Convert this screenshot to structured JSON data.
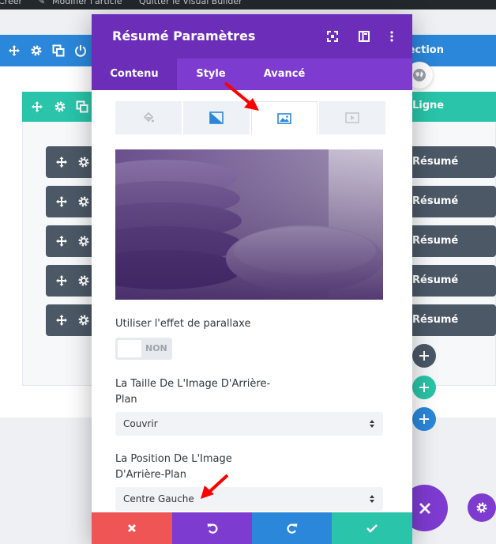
{
  "top_bar": {
    "items": [
      "Créer",
      "Modifier l'article",
      "Quitter le Visual Builder"
    ]
  },
  "section": {
    "label": "Section"
  },
  "row": {
    "label": "Ligne"
  },
  "modules": [
    {
      "label": "Résumé"
    },
    {
      "label": "Résumé"
    },
    {
      "label": "Résumé"
    },
    {
      "label": "Résumé"
    },
    {
      "label": "Résumé"
    }
  ],
  "modal": {
    "title": "Résumé Paramètres",
    "tabs": [
      "Contenu",
      "Style",
      "Avancé"
    ],
    "active_tab": "Contenu",
    "background_tabs": [
      "color-icon",
      "gradient-icon",
      "image-icon",
      "video-icon"
    ],
    "active_background_tab": "image-icon",
    "parallax": {
      "label": "Utiliser l'effet de parallaxe",
      "value": "NON"
    },
    "image_size": {
      "label_line1": "La Taille De L'Image D'Arrière-",
      "label_line2": "Plan",
      "value": "Couvrir"
    },
    "image_position": {
      "label_line1": "La Position De L'Image",
      "label_line2": "D'Arrière-Plan",
      "value": "Centre Gauche"
    }
  },
  "colors": {
    "section_blue": "#2b87da",
    "row_teal": "#29c4a9",
    "module_dark": "#4c5866",
    "modal_purple": "#6c2eb9",
    "tab_purple": "#7e3bd0",
    "cancel_red": "#ef5555",
    "undo_purple": "#7e3bd0",
    "redo_blue": "#2b87da",
    "save_green": "#29c4a9",
    "annotation_red": "#ff0000"
  }
}
